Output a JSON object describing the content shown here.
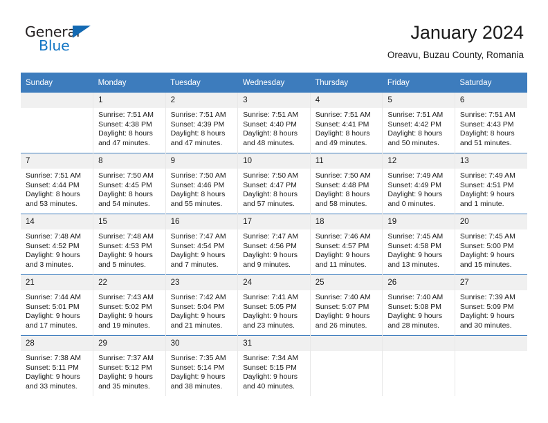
{
  "branding": {
    "logo_text_primary": "General",
    "logo_text_secondary": "Blue",
    "logo_triangle_icon": "triangle-icon",
    "primary_color": "#3d7cbd",
    "logo_blue": "#1275c4"
  },
  "header": {
    "title": "January 2024",
    "subtitle": "Oreavu, Buzau County, Romania"
  },
  "calendar": {
    "weekday_headers": [
      "Sunday",
      "Monday",
      "Tuesday",
      "Wednesday",
      "Thursday",
      "Friday",
      "Saturday"
    ],
    "weeks": [
      [
        {
          "day": "",
          "empty": true,
          "sunrise": "",
          "sunset": "",
          "daylight_line1": "",
          "daylight_line2": ""
        },
        {
          "day": "1",
          "sunrise": "Sunrise: 7:51 AM",
          "sunset": "Sunset: 4:38 PM",
          "daylight_line1": "Daylight: 8 hours",
          "daylight_line2": "and 47 minutes."
        },
        {
          "day": "2",
          "sunrise": "Sunrise: 7:51 AM",
          "sunset": "Sunset: 4:39 PM",
          "daylight_line1": "Daylight: 8 hours",
          "daylight_line2": "and 47 minutes."
        },
        {
          "day": "3",
          "sunrise": "Sunrise: 7:51 AM",
          "sunset": "Sunset: 4:40 PM",
          "daylight_line1": "Daylight: 8 hours",
          "daylight_line2": "and 48 minutes."
        },
        {
          "day": "4",
          "sunrise": "Sunrise: 7:51 AM",
          "sunset": "Sunset: 4:41 PM",
          "daylight_line1": "Daylight: 8 hours",
          "daylight_line2": "and 49 minutes."
        },
        {
          "day": "5",
          "sunrise": "Sunrise: 7:51 AM",
          "sunset": "Sunset: 4:42 PM",
          "daylight_line1": "Daylight: 8 hours",
          "daylight_line2": "and 50 minutes."
        },
        {
          "day": "6",
          "sunrise": "Sunrise: 7:51 AM",
          "sunset": "Sunset: 4:43 PM",
          "daylight_line1": "Daylight: 8 hours",
          "daylight_line2": "and 51 minutes."
        }
      ],
      [
        {
          "day": "7",
          "sunrise": "Sunrise: 7:51 AM",
          "sunset": "Sunset: 4:44 PM",
          "daylight_line1": "Daylight: 8 hours",
          "daylight_line2": "and 53 minutes."
        },
        {
          "day": "8",
          "sunrise": "Sunrise: 7:50 AM",
          "sunset": "Sunset: 4:45 PM",
          "daylight_line1": "Daylight: 8 hours",
          "daylight_line2": "and 54 minutes."
        },
        {
          "day": "9",
          "sunrise": "Sunrise: 7:50 AM",
          "sunset": "Sunset: 4:46 PM",
          "daylight_line1": "Daylight: 8 hours",
          "daylight_line2": "and 55 minutes."
        },
        {
          "day": "10",
          "sunrise": "Sunrise: 7:50 AM",
          "sunset": "Sunset: 4:47 PM",
          "daylight_line1": "Daylight: 8 hours",
          "daylight_line2": "and 57 minutes."
        },
        {
          "day": "11",
          "sunrise": "Sunrise: 7:50 AM",
          "sunset": "Sunset: 4:48 PM",
          "daylight_line1": "Daylight: 8 hours",
          "daylight_line2": "and 58 minutes."
        },
        {
          "day": "12",
          "sunrise": "Sunrise: 7:49 AM",
          "sunset": "Sunset: 4:49 PM",
          "daylight_line1": "Daylight: 9 hours",
          "daylight_line2": "and 0 minutes."
        },
        {
          "day": "13",
          "sunrise": "Sunrise: 7:49 AM",
          "sunset": "Sunset: 4:51 PM",
          "daylight_line1": "Daylight: 9 hours",
          "daylight_line2": "and 1 minute."
        }
      ],
      [
        {
          "day": "14",
          "sunrise": "Sunrise: 7:48 AM",
          "sunset": "Sunset: 4:52 PM",
          "daylight_line1": "Daylight: 9 hours",
          "daylight_line2": "and 3 minutes."
        },
        {
          "day": "15",
          "sunrise": "Sunrise: 7:48 AM",
          "sunset": "Sunset: 4:53 PM",
          "daylight_line1": "Daylight: 9 hours",
          "daylight_line2": "and 5 minutes."
        },
        {
          "day": "16",
          "sunrise": "Sunrise: 7:47 AM",
          "sunset": "Sunset: 4:54 PM",
          "daylight_line1": "Daylight: 9 hours",
          "daylight_line2": "and 7 minutes."
        },
        {
          "day": "17",
          "sunrise": "Sunrise: 7:47 AM",
          "sunset": "Sunset: 4:56 PM",
          "daylight_line1": "Daylight: 9 hours",
          "daylight_line2": "and 9 minutes."
        },
        {
          "day": "18",
          "sunrise": "Sunrise: 7:46 AM",
          "sunset": "Sunset: 4:57 PM",
          "daylight_line1": "Daylight: 9 hours",
          "daylight_line2": "and 11 minutes."
        },
        {
          "day": "19",
          "sunrise": "Sunrise: 7:45 AM",
          "sunset": "Sunset: 4:58 PM",
          "daylight_line1": "Daylight: 9 hours",
          "daylight_line2": "and 13 minutes."
        },
        {
          "day": "20",
          "sunrise": "Sunrise: 7:45 AM",
          "sunset": "Sunset: 5:00 PM",
          "daylight_line1": "Daylight: 9 hours",
          "daylight_line2": "and 15 minutes."
        }
      ],
      [
        {
          "day": "21",
          "sunrise": "Sunrise: 7:44 AM",
          "sunset": "Sunset: 5:01 PM",
          "daylight_line1": "Daylight: 9 hours",
          "daylight_line2": "and 17 minutes."
        },
        {
          "day": "22",
          "sunrise": "Sunrise: 7:43 AM",
          "sunset": "Sunset: 5:02 PM",
          "daylight_line1": "Daylight: 9 hours",
          "daylight_line2": "and 19 minutes."
        },
        {
          "day": "23",
          "sunrise": "Sunrise: 7:42 AM",
          "sunset": "Sunset: 5:04 PM",
          "daylight_line1": "Daylight: 9 hours",
          "daylight_line2": "and 21 minutes."
        },
        {
          "day": "24",
          "sunrise": "Sunrise: 7:41 AM",
          "sunset": "Sunset: 5:05 PM",
          "daylight_line1": "Daylight: 9 hours",
          "daylight_line2": "and 23 minutes."
        },
        {
          "day": "25",
          "sunrise": "Sunrise: 7:40 AM",
          "sunset": "Sunset: 5:07 PM",
          "daylight_line1": "Daylight: 9 hours",
          "daylight_line2": "and 26 minutes."
        },
        {
          "day": "26",
          "sunrise": "Sunrise: 7:40 AM",
          "sunset": "Sunset: 5:08 PM",
          "daylight_line1": "Daylight: 9 hours",
          "daylight_line2": "and 28 minutes."
        },
        {
          "day": "27",
          "sunrise": "Sunrise: 7:39 AM",
          "sunset": "Sunset: 5:09 PM",
          "daylight_line1": "Daylight: 9 hours",
          "daylight_line2": "and 30 minutes."
        }
      ],
      [
        {
          "day": "28",
          "sunrise": "Sunrise: 7:38 AM",
          "sunset": "Sunset: 5:11 PM",
          "daylight_line1": "Daylight: 9 hours",
          "daylight_line2": "and 33 minutes."
        },
        {
          "day": "29",
          "sunrise": "Sunrise: 7:37 AM",
          "sunset": "Sunset: 5:12 PM",
          "daylight_line1": "Daylight: 9 hours",
          "daylight_line2": "and 35 minutes."
        },
        {
          "day": "30",
          "sunrise": "Sunrise: 7:35 AM",
          "sunset": "Sunset: 5:14 PM",
          "daylight_line1": "Daylight: 9 hours",
          "daylight_line2": "and 38 minutes."
        },
        {
          "day": "31",
          "sunrise": "Sunrise: 7:34 AM",
          "sunset": "Sunset: 5:15 PM",
          "daylight_line1": "Daylight: 9 hours",
          "daylight_line2": "and 40 minutes."
        },
        {
          "day": "",
          "empty": true,
          "sunrise": "",
          "sunset": "",
          "daylight_line1": "",
          "daylight_line2": ""
        },
        {
          "day": "",
          "empty": true,
          "sunrise": "",
          "sunset": "",
          "daylight_line1": "",
          "daylight_line2": ""
        },
        {
          "day": "",
          "empty": true,
          "sunrise": "",
          "sunset": "",
          "daylight_line1": "",
          "daylight_line2": ""
        }
      ]
    ]
  }
}
